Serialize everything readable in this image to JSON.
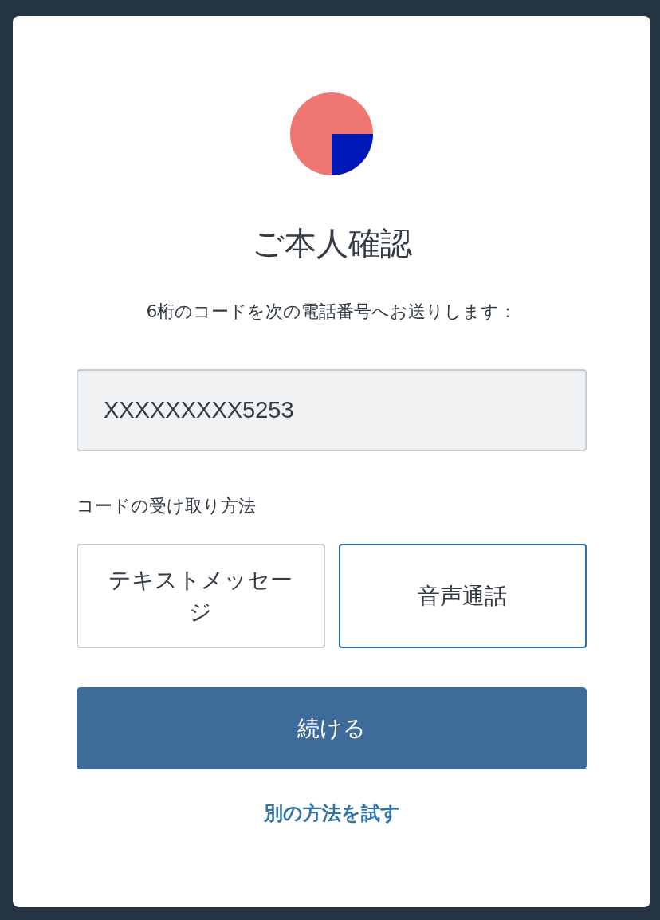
{
  "title": "ご本人確認",
  "subtitle": "6桁のコードを次の電話番号へお送りします：",
  "phone_field": {
    "value": "XXXXXXXXX5253"
  },
  "delivery": {
    "label": "コードの受け取り方法",
    "options": [
      {
        "label": "テキストメッセージ",
        "selected": false
      },
      {
        "label": "音声通話",
        "selected": true
      }
    ]
  },
  "continue_button": {
    "label": "続ける"
  },
  "alternate_link": {
    "label": "別の方法を試す"
  }
}
